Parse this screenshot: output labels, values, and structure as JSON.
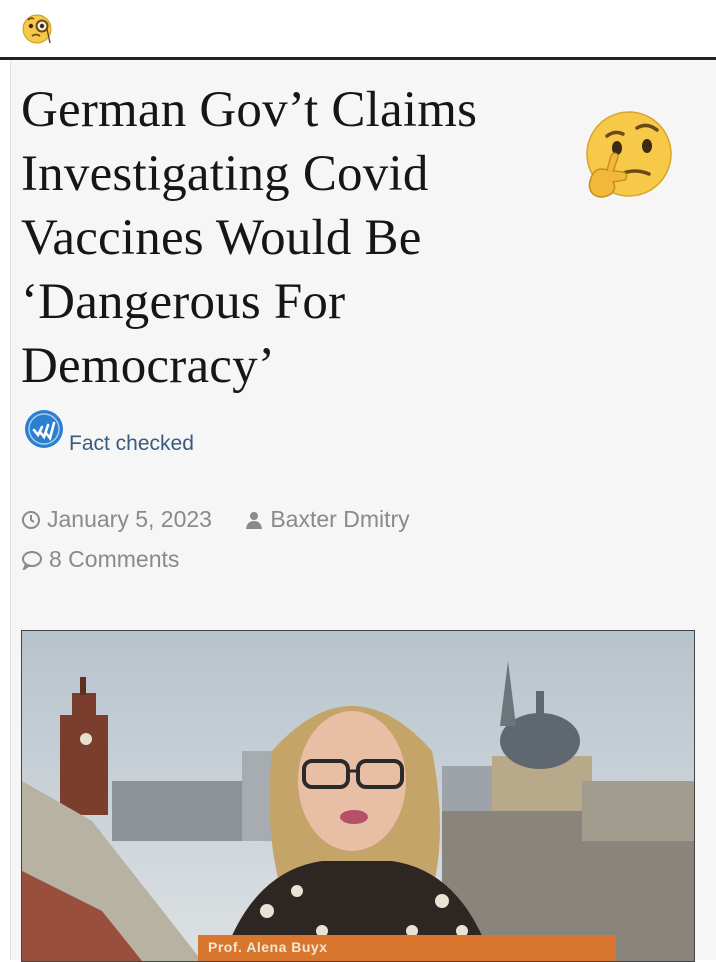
{
  "top_bar": {
    "emoji_icon": "face-with-monocle-icon"
  },
  "article": {
    "headline_lines": [
      "German Gov’t Claims",
      "Investigating Covid",
      "Vaccines Would Be",
      "‘Dangerous For",
      "Democracy’"
    ],
    "thinking_emoji_icon": "thinking-face-icon",
    "fact_check": {
      "badge_icon": "fact-check-badge-icon",
      "label": "Fact checked",
      "badge_color": "#2a7fd0"
    },
    "meta": {
      "date": "January 5, 2023",
      "author": "Baxter Dmitry",
      "comments": "8 Comments"
    },
    "video": {
      "caption": "Prof. Alena Buyx",
      "caption_bar_color": "#d9762e"
    }
  }
}
